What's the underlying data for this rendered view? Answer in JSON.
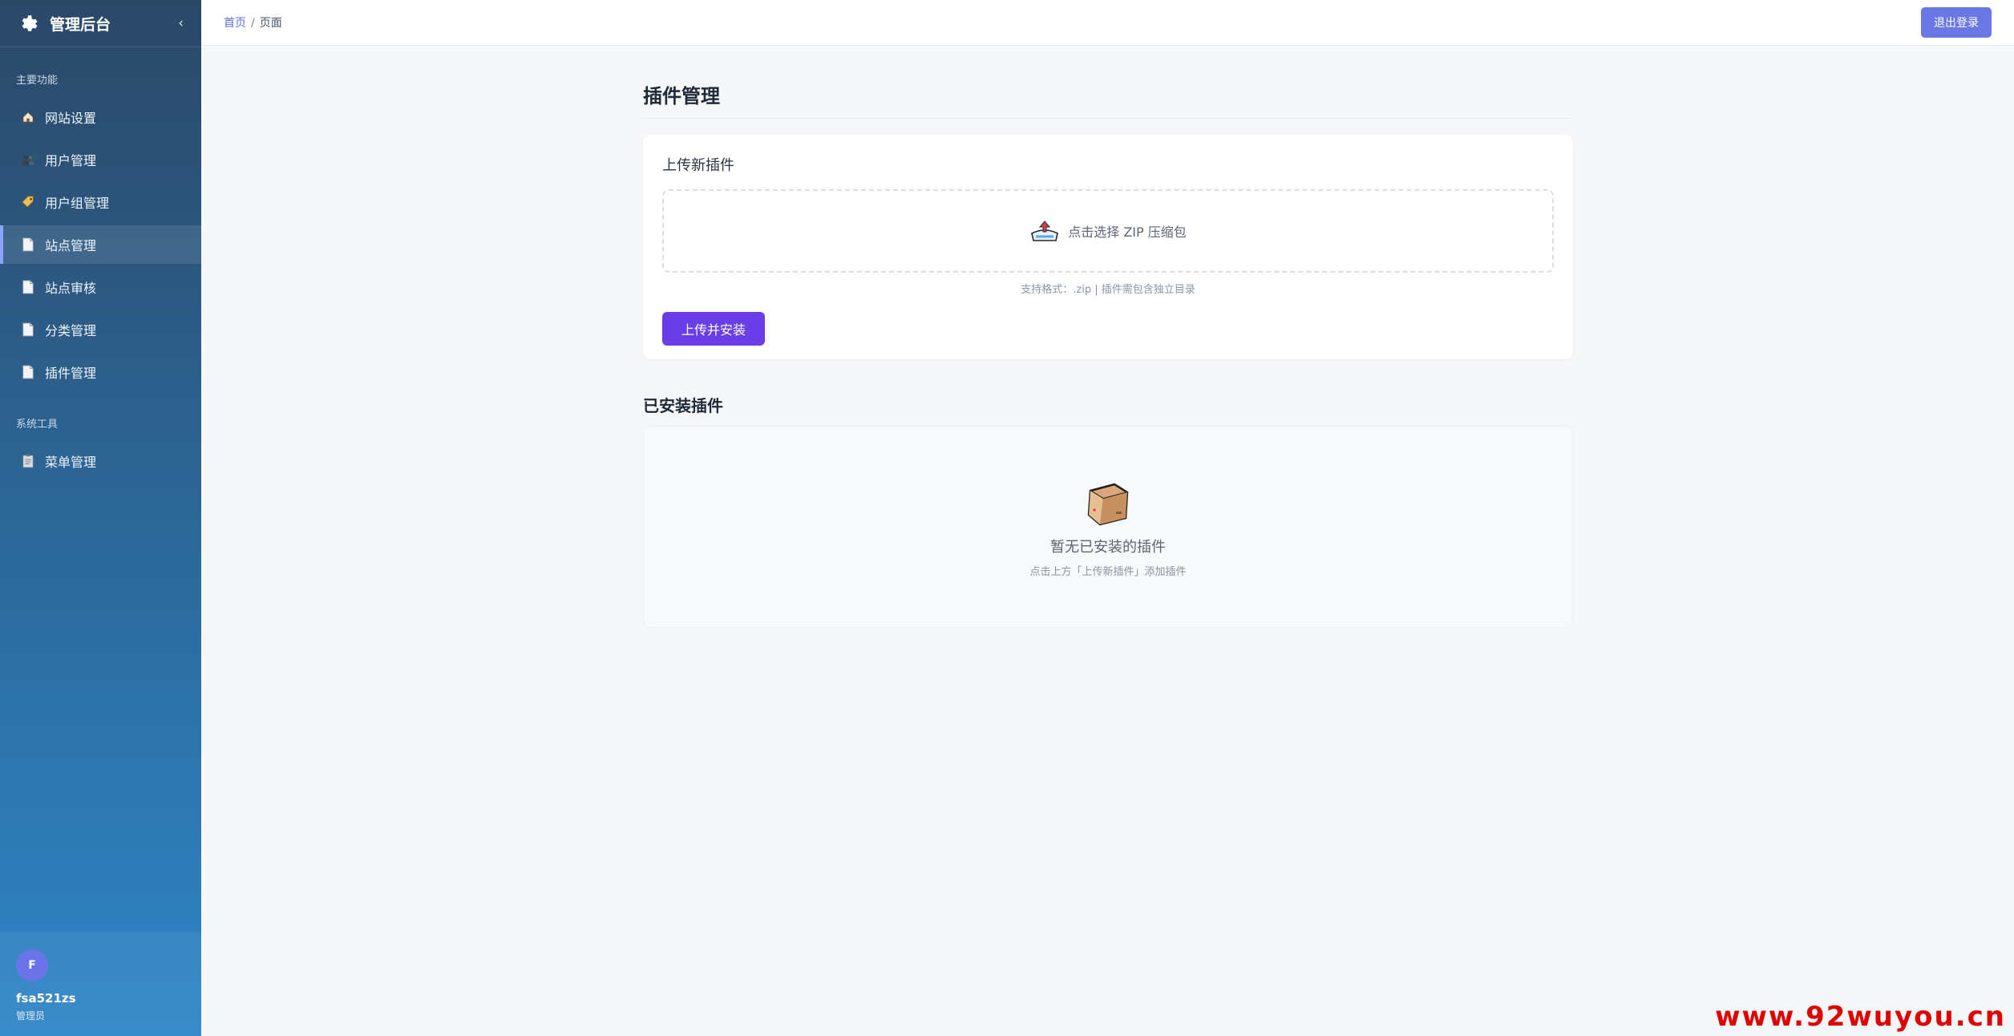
{
  "sidebar": {
    "brand": "管理后台",
    "collapse": "‹",
    "section_main": "主要功能",
    "section_tools": "系统工具",
    "items": [
      {
        "label": "网站设置",
        "icon": "house-icon"
      },
      {
        "label": "用户管理",
        "icon": "users-icon"
      },
      {
        "label": "用户组管理",
        "icon": "tag-icon"
      },
      {
        "label": "站点管理",
        "icon": "page-icon"
      },
      {
        "label": "站点审核",
        "icon": "page-icon"
      },
      {
        "label": "分类管理",
        "icon": "page-icon"
      },
      {
        "label": "插件管理",
        "icon": "page-icon"
      }
    ],
    "tools": [
      {
        "label": "菜单管理",
        "icon": "clipboard-icon"
      }
    ],
    "user": {
      "initial": "F",
      "name": "fsa521zs",
      "role": "管理员"
    }
  },
  "header": {
    "breadcrumb_home": "首页",
    "breadcrumb_sep": "/",
    "breadcrumb_current": "页面",
    "logout": "退出登录"
  },
  "main": {
    "title": "插件管理",
    "upload": {
      "title": "上传新插件",
      "dropzone": "点击选择 ZIP 压缩包",
      "hint": "支持格式：.zip | 插件需包含独立目录",
      "button": "上传并安装"
    },
    "installed": {
      "title": "已安装插件",
      "empty_title": "暂无已安装的插件",
      "empty_sub": "点击上方「上传新插件」添加插件"
    }
  },
  "watermark": "www.92wuyou.cn",
  "colors": {
    "accent": "#6a3ee6",
    "logout": "#6a78e6",
    "link": "#5b6ee1"
  }
}
